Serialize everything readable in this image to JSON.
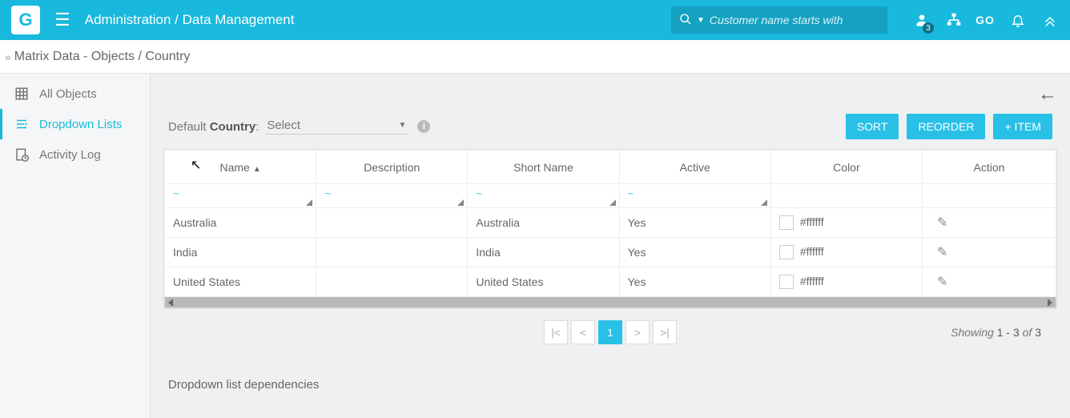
{
  "header": {
    "logo_letter": "G",
    "breadcrumb": "Administration / Data Management",
    "search_placeholder": "Customer name starts with",
    "badge_count": "3",
    "go_label": "GO"
  },
  "subheader": {
    "title": "Matrix Data - Objects / Country"
  },
  "sidebar": {
    "items": [
      {
        "label": "All Objects"
      },
      {
        "label": "Dropdown Lists"
      },
      {
        "label": "Activity Log"
      }
    ]
  },
  "toolbar": {
    "default_prefix": "Default ",
    "default_bold": "Country",
    "default_suffix": ":",
    "select_placeholder": "Select",
    "sort_label": "SORT",
    "reorder_label": "REORDER",
    "add_item_label": "+ ITEM"
  },
  "table": {
    "headers": {
      "name": "Name",
      "description": "Description",
      "short_name": "Short Name",
      "active": "Active",
      "color": "Color",
      "action": "Action"
    },
    "rows": [
      {
        "name": "Australia",
        "description": "",
        "short_name": "Australia",
        "active": "Yes",
        "color": "#ffffff"
      },
      {
        "name": "India",
        "description": "",
        "short_name": "India",
        "active": "Yes",
        "color": "#ffffff"
      },
      {
        "name": "United States",
        "description": "",
        "short_name": "United States",
        "active": "Yes",
        "color": "#ffffff"
      }
    ]
  },
  "pager": {
    "current": "1",
    "info_prefix": "Showing ",
    "info_range": "1 - 3",
    "info_mid": " of ",
    "info_total": "3"
  },
  "deps": {
    "title": "Dropdown list dependencies"
  }
}
